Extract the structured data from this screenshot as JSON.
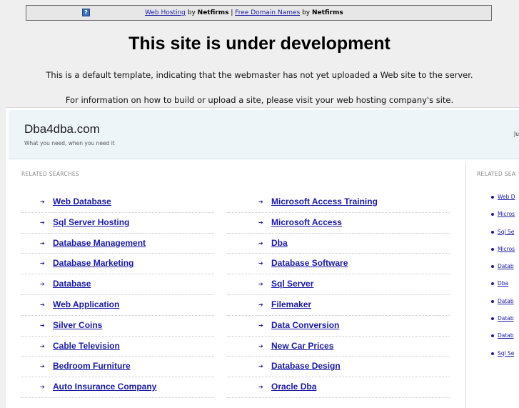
{
  "topbar": {
    "help_icon": "question-icon",
    "link1": "Web Hosting",
    "by1": " by ",
    "brand1": "Netfirms",
    "sep": " | ",
    "link2": "Free Domain Names",
    "by2": " by ",
    "brand2": "Netfirms"
  },
  "headline": "This site is under development",
  "notes": [
    "This is a default template, indicating that the webmaster has not yet uploaded a Web site to the server.",
    "For information on how to build or upload a site, please visit your web hosting company's site."
  ],
  "site": {
    "title": "Dba4dba.com",
    "tagline": "What you need, when you need it",
    "right_text": "Ju"
  },
  "related": {
    "label": "RELATED SEARCHES",
    "left": [
      "Web Database",
      "Sql Server Hosting",
      "Database Management",
      "Database Marketing",
      "Database",
      "Web Application",
      "Silver Coins",
      "Cable Television",
      "Bedroom Furniture",
      "Auto Insurance Company"
    ],
    "right": [
      "Microsoft Access Training",
      "Microsoft Access",
      "Dba",
      "Database Software",
      "Sql Server",
      "Filemaker",
      "Data Conversion",
      "New Car Prices",
      "Database Design",
      "Oracle Dba"
    ]
  },
  "sidebar": {
    "label": "RELATED SEA",
    "items": [
      "Web D",
      "Micros",
      "Sql Se",
      "Micros",
      "Datab",
      "Dba",
      "Datab",
      "Datab",
      "Datab",
      "Sql Se"
    ]
  }
}
